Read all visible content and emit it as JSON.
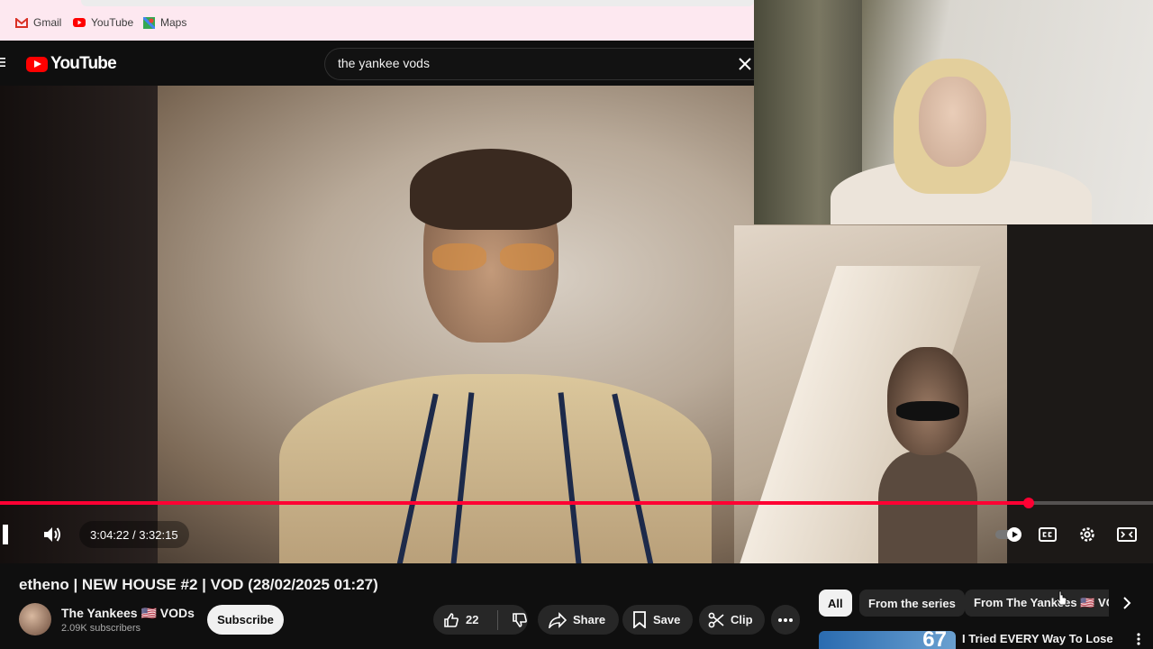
{
  "bookmarks": [
    {
      "label": "Gmail",
      "icon": "gmail-icon"
    },
    {
      "label": "YouTube",
      "icon": "youtube-icon"
    },
    {
      "label": "Maps",
      "icon": "maps-icon"
    }
  ],
  "header": {
    "logo_text": "YouTube",
    "search_value": "the yankee vods"
  },
  "player": {
    "time_display": "3:04:22 / 3:32:15",
    "progress_fraction": 0.8918,
    "accent_color": "#ff0033"
  },
  "video": {
    "title": "etheno | NEW HOUSE #2 | VOD (28/02/2025 01:27)",
    "channel_name": "The Yankees 🇺🇸 VODs",
    "subscribers": "2.09K subscribers",
    "subscribe_label": "Subscribe",
    "like_count": "22",
    "share_label": "Share",
    "save_label": "Save",
    "clip_label": "Clip"
  },
  "chips": {
    "all": "All",
    "series": "From the series",
    "channel": "From The Yankees 🇺🇸 VOI"
  },
  "recommendation": {
    "title": "I Tried EVERY Way To Lose",
    "thumb_text": "67"
  }
}
